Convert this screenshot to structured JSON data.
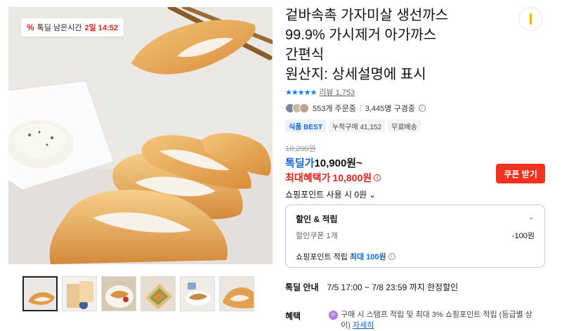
{
  "timer": {
    "icon": "percent-icon",
    "label": "톡딜 남은시간",
    "remaining": "2일 14:52"
  },
  "product": {
    "title_lines": [
      "겉바속촉 가자미살 생선까스",
      "99.9% 가시제거 아가까스",
      "간편식",
      "원산지: 상세설명에 표시"
    ],
    "rating": 4.5,
    "review_label": "리뷰 1,753",
    "orders": "553개 주문중",
    "subscribers": "3,445명 구경중"
  },
  "badges": [
    {
      "label": "식품 BEST",
      "style": "best"
    },
    {
      "label": "누적구매 41,152",
      "style": "plain"
    },
    {
      "label": "무료배송",
      "style": "plain"
    }
  ],
  "price": {
    "original": "10,200원",
    "sale_label": "톡딜가",
    "sale_value": "10,900원~",
    "max_label": "최대혜택가",
    "max_value": "10,800원",
    "coupon_button": "쿠폰 받기",
    "points_usage": "쇼핑포인트 사용 시 0원"
  },
  "discount_box": {
    "heading": "할인 & 적립",
    "coupon_label": "할인쿠폰 1개",
    "coupon_value": "-100원",
    "points_label": "쇼핑포인트 적립",
    "points_max_prefix": "최대",
    "points_max_value": "100원"
  },
  "deal": {
    "label": "톡딜 안내",
    "text": "7/5 17:00 ~ 7/8 23:59 까지 한정할인"
  },
  "benefit": {
    "label": "혜택",
    "text": "구매 시 스탬프 적립 및 최대 3% 쇼핑포인트 적립 (등급별 상이)",
    "link": "자세히"
  },
  "thumbnails": [
    "fish-cutlet-1",
    "package",
    "plated-dish",
    "sandwich",
    "side-dish",
    "cutlet-closeup"
  ],
  "colors": {
    "accent_blue": "#1664d6",
    "sale_red": "#e2231a",
    "coupon_button": "#f0321e"
  }
}
